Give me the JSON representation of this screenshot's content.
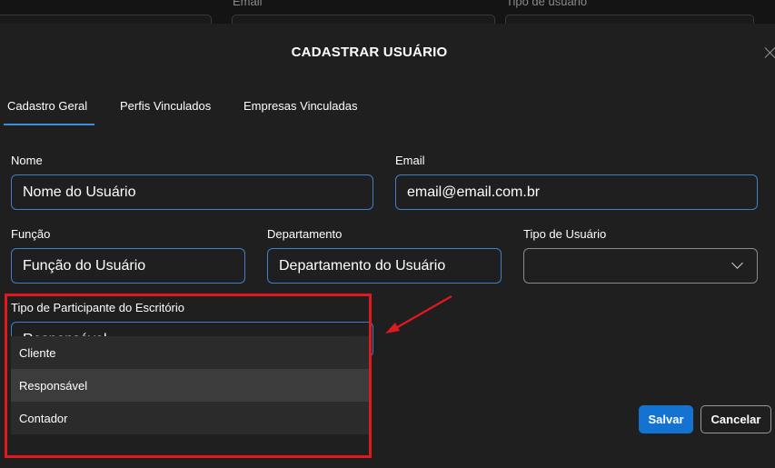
{
  "background": {
    "labels": [
      "Email",
      "Tipo de usuário"
    ]
  },
  "modal": {
    "title": "CADASTRAR USUÁRIO",
    "tabs": [
      {
        "label": "Cadastro Geral",
        "active": true
      },
      {
        "label": "Perfis Vinculados",
        "active": false
      },
      {
        "label": "Empresas Vinculadas",
        "active": false
      }
    ]
  },
  "form": {
    "nome": {
      "label": "Nome",
      "value": "Nome do Usuário"
    },
    "email": {
      "label": "Email",
      "value": "email@email.com.br"
    },
    "funcao": {
      "label": "Função",
      "value": "Função do Usuário"
    },
    "departamento": {
      "label": "Departamento",
      "value": "Departamento do Usuário"
    },
    "tipo_usuario": {
      "label": "Tipo de Usuário",
      "value": ""
    },
    "tipo_participante": {
      "label": "Tipo de Participante do Escritório",
      "value": "Responsável",
      "options": [
        "Cliente",
        "Responsável",
        "Contador"
      ],
      "highlighted_option": "Responsável"
    }
  },
  "actions": {
    "save_label": "Salvar",
    "cancel_label": "Cancelar"
  },
  "colors": {
    "accent": "#1473d1",
    "focus_border": "#3f7fc9",
    "annotation": "#e0191e",
    "background": "#1f1f1f"
  },
  "icons": {
    "close": "close-icon",
    "dropdown": "chevron-down-icon",
    "annotation_arrow": "arrow-icon"
  }
}
